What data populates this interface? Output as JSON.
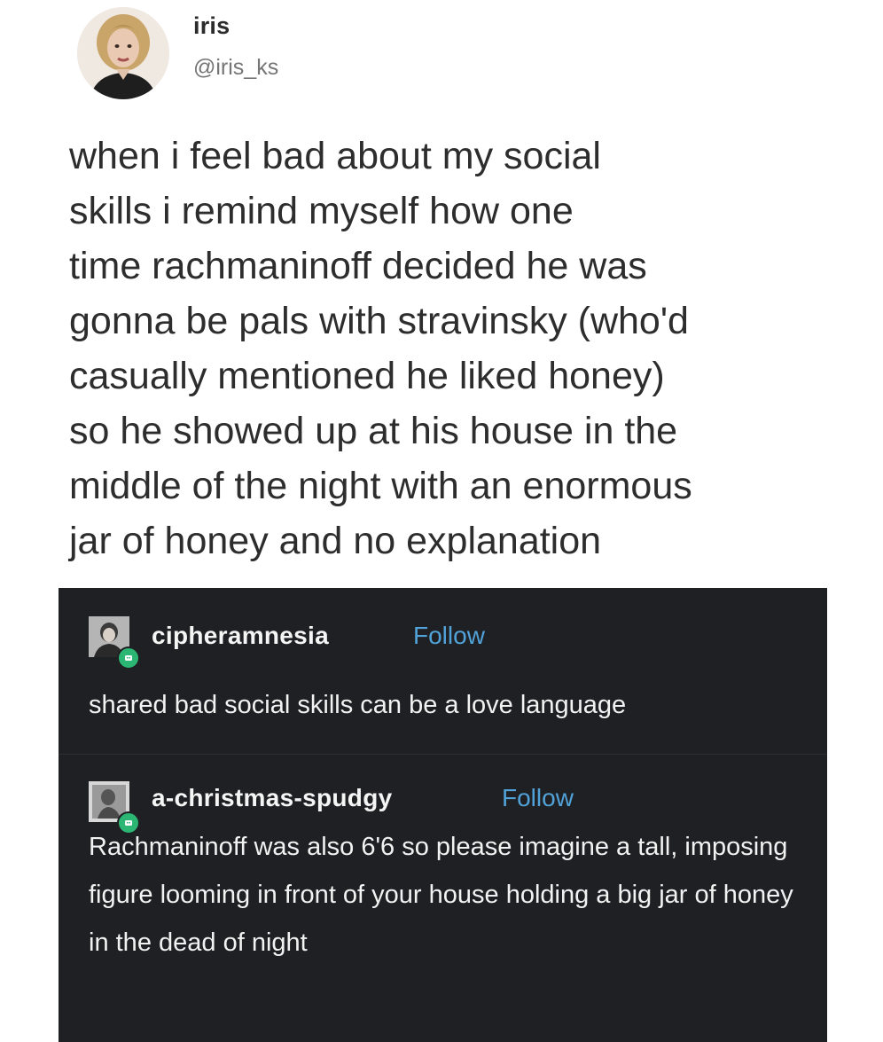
{
  "tweet": {
    "name": "iris",
    "handle": "@iris_ks",
    "text": "when i feel bad about my social\nskills i remind myself how one\ntime rachmaninoff decided he was\ngonna be pals with stravinsky (who'd\ncasually mentioned he liked honey)\nso he showed up at his house in the\nmiddle of the night with an enormous\njar of honey and no explanation"
  },
  "replies": [
    {
      "username": "cipheramnesia",
      "follow_label": "Follow",
      "text": "shared bad social skills can be a love language"
    },
    {
      "username": "a-christmas-spudgy",
      "follow_label": "Follow",
      "text": "Rachmaninoff was also 6'6 so please imagine a tall, imposing figure looming in front of your house holding a big jar of honey in the dead of night"
    }
  ],
  "colors": {
    "tumblr_background": "#1f2023",
    "follow_link": "#51a2d8",
    "badge": "#2bb673"
  }
}
